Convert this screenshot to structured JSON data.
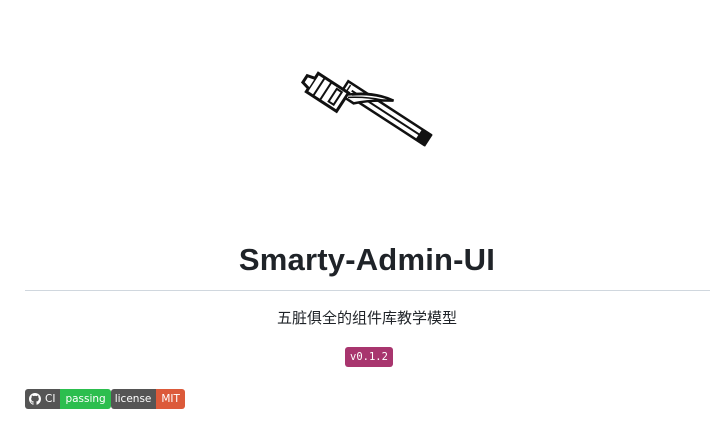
{
  "readme": {
    "logo_icon": "hammer-icon",
    "title": "Smarty-Admin-UI",
    "subtitle": "五脏俱全的组件库教学模型",
    "version_badge": "v0.1.2",
    "badges": [
      {
        "icon": "github-icon",
        "label": "CI",
        "value": "passing",
        "value_color": "#2cbe4e"
      },
      {
        "label": "license",
        "value": "MIT",
        "value_color": "#dc5a3a"
      }
    ],
    "colors": {
      "version_badge": "#a8356e",
      "badge_label": "#555555",
      "divider": "#d0d7de",
      "text": "#1f2328"
    }
  }
}
